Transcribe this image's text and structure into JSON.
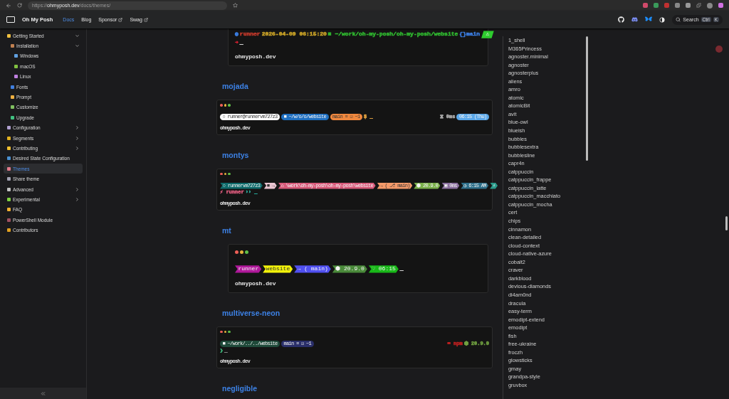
{
  "browser": {
    "url_scheme": "https://",
    "url_host": "ohmyposh.dev",
    "url_path": "/docs/themes/"
  },
  "navbar": {
    "brand": "Oh My Posh",
    "links": [
      {
        "label": "Docs",
        "selected": true,
        "external": false
      },
      {
        "label": "Blog",
        "selected": false,
        "external": false
      },
      {
        "label": "Sponsor",
        "selected": false,
        "external": true
      },
      {
        "label": "Swag",
        "selected": false,
        "external": true
      }
    ],
    "search": {
      "label": "Search",
      "keys": [
        "Ctrl",
        "K"
      ]
    }
  },
  "sidebar": {
    "items": [
      {
        "label": "Getting Started",
        "color": "#f0c040",
        "expanded": true,
        "selected": false,
        "children": [
          {
            "label": "Installation",
            "color": "#c08050",
            "expanded": true,
            "selected": false,
            "children": [
              {
                "label": "Windows",
                "color": "#60a0e0",
                "selected": false
              },
              {
                "label": "macOS",
                "color": "#80c040",
                "selected": false
              },
              {
                "label": "Linux",
                "color": "#c080e0",
                "selected": false
              }
            ]
          },
          {
            "label": "Fonts",
            "color": "#4080e0",
            "selected": false
          },
          {
            "label": "Prompt",
            "color": "#f0b040",
            "selected": false
          },
          {
            "label": "Customize",
            "color": "#80c060",
            "selected": false
          },
          {
            "label": "Upgrade",
            "color": "#40c080",
            "selected": false
          }
        ]
      },
      {
        "label": "Configuration",
        "color": "#b0a0d0",
        "expanded": false,
        "selected": false
      },
      {
        "label": "Segments",
        "color": "#e0b020",
        "expanded": false,
        "selected": false
      },
      {
        "label": "Contributing",
        "color": "#f0c030",
        "expanded": false,
        "selected": false
      },
      {
        "label": "Desired State Configuration",
        "color": "#4a90d0",
        "selected": false
      },
      {
        "label": "Themes",
        "color": "#e07a8a",
        "selected": true
      },
      {
        "label": "Share theme",
        "color": "#a0a0b0",
        "selected": false
      },
      {
        "label": "Advanced",
        "color": "#c0c0c0",
        "expanded": false,
        "selected": false
      },
      {
        "label": "Experimental",
        "color": "#80d040",
        "expanded": false,
        "selected": false
      },
      {
        "label": "FAQ",
        "color": "#f0b030",
        "selected": false
      },
      {
        "label": "PowerShell Module",
        "color": "#a05060",
        "selected": false
      },
      {
        "label": "Contributors",
        "color": "#e0a020",
        "selected": false
      }
    ]
  },
  "themes": [
    {
      "terminal": {
        "kind": "wide",
        "lines": [
          {
            "segments": [
              {
                "text": "◉",
                "kind": "text",
                "color": "#3b7de0"
              },
              {
                "text": "runner",
                "kind": "text",
                "color": "#c0392b"
              },
              {
                "text": "2026-04-09 06:15:20",
                "kind": "text",
                "color": "#c9a227"
              },
              {
                "text": "■ ~/work/oh-my-posh/oh-my-posh/website",
                "kind": "text",
                "color": "#2fb52f"
              },
              {
                "text": "{}main",
                "kind": "text",
                "color": "#3b7de0"
              },
              {
                "text": "⚠",
                "kind": "slant",
                "color": "#2ecc2e"
              }
            ]
          },
          {
            "segments": [
              {
                "text": "➜",
                "kind": "text",
                "color": "#d02030"
              },
              {
                "text": "_",
                "kind": "text",
                "color": "#dddddd"
              }
            ]
          }
        ],
        "footer": "ohmyposh.dev"
      }
    },
    {
      "heading": "mojada",
      "terminal": {
        "kind": "compact",
        "lines": [
          {
            "segments": [
              {
                "text": "○ runner@runnervm727z3",
                "kind": "pill",
                "color": "#ffffff"
              },
              {
                "text": "■ ~/w/o/o/website",
                "kind": "pill",
                "color": "#1f6fc0"
              },
              {
                "text": "main ≡ ☑ ~1",
                "kind": "pill",
                "color": "#f0883e"
              },
              {
                "text": "$ _",
                "kind": "text",
                "color": "#e0a040"
              }
            ],
            "right_segments": [
              {
                "text": "⧖ 0ms",
                "kind": "text",
                "color": "#aaaaaa"
              },
              {
                "text": "06:15 (Thu)",
                "kind": "pill",
                "color": "#5aa7e8"
              }
            ]
          }
        ],
        "footer": "ohmyposh.dev"
      }
    },
    {
      "heading": "montys",
      "terminal": {
        "kind": "compact",
        "lines": [
          {
            "segments": [
              {
                "text": "○ runnervm727z3",
                "kind": "powerline",
                "color": "#0e6b6b"
              },
              {
                "text": "■ →",
                "kind": "powerline",
                "color": "#e9c4d0"
              },
              {
                "text": "⌂ \\work\\oh-my-posh\\oh-my-posh\\website",
                "kind": "powerline",
                "color": "#d85a7a"
              },
              {
                "text": "→ ( ⎇ main)",
                "kind": "powerline",
                "color": "#f49a6a"
              },
              {
                "text": "⬢ 20.9.0",
                "kind": "powerline",
                "color": "#7ab04a"
              },
              {
                "text": "▣ 0ms",
                "kind": "powerline",
                "color": "#8a6f9e"
              },
              {
                "text": "◷ 6:15 AM",
                "kind": "powerline",
                "color": "#2e6f8a"
              },
              {
                "text": "⚡",
                "kind": "powerline",
                "color": "#2a9a8a"
              }
            ]
          },
          {
            "segments": [
              {
                "text": "⚡ runner",
                "kind": "text",
                "color": "#d85a7a"
              },
              {
                "text": "›› _",
                "kind": "text",
                "color": "#2ab0a0"
              }
            ]
          }
        ],
        "footer": "ohmyposh.dev"
      }
    },
    {
      "heading": "mt",
      "terminal": {
        "kind": "wide",
        "lines": [
          {
            "segments": [
              {
                "text": "runner",
                "kind": "powerline",
                "color": "#b0189a"
              },
              {
                "text": "website",
                "kind": "powerline",
                "color": "#f2f20a"
              },
              {
                "text": "→ ( main)",
                "kind": "powerline",
                "color": "#5050f0"
              },
              {
                "text": "⬢ 20.9.0",
                "kind": "powerline",
                "color": "#4a8a3a"
              },
              {
                "text": "♡ 06:15",
                "kind": "powerline",
                "color": "#18b818"
              },
              {
                "text": "_",
                "kind": "text",
                "color": "#dddddd"
              }
            ]
          }
        ],
        "footer": "ohmyposh.dev"
      }
    },
    {
      "heading": "multiverse-neon",
      "terminal": {
        "kind": "compact",
        "lines": [
          {
            "segments": [
              {
                "text": "■ ~/work/../../website",
                "kind": "pill",
                "color": "#1f4a3a"
              },
              {
                "text": "main ≡ ☑ ~1",
                "kind": "pill",
                "color": "#2a2f6a"
              }
            ],
            "right_segments": [
              {
                "text": "⌨ npm",
                "kind": "text",
                "color": "#c02020"
              },
              {
                "text": "⬢ 20.9.0",
                "kind": "text",
                "color": "#70a040"
              }
            ]
          },
          {
            "segments": [
              {
                "text": "❯",
                "kind": "text",
                "color": "#40c080"
              },
              {
                "text": "_",
                "kind": "text",
                "color": "#888888"
              }
            ]
          }
        ],
        "footer": "ohmyposh.dev"
      }
    },
    {
      "heading": "negligible"
    }
  ],
  "toc": [
    "1_shell",
    "M365Princess",
    "agnoster.minimal",
    "agnoster",
    "agnosterplus",
    "aliens",
    "amro",
    "atomic",
    "atomicBit",
    "avit",
    "blue-owl",
    "blueish",
    "bubbles",
    "bubblesextra",
    "bubblesline",
    "capr4n",
    "catppuccin",
    "catppuccin_frappe",
    "catppuccin_latte",
    "catppuccin_macchiato",
    "catppuccin_mocha",
    "cert",
    "chips",
    "cinnamon",
    "clean-detailed",
    "cloud-context",
    "cloud-native-azure",
    "cobalt2",
    "craver",
    "darkblood",
    "devious-diamonds",
    "di4am0nd",
    "dracula",
    "easy-term",
    "emodipt-extend",
    "emodipt",
    "fish",
    "free-ukraine",
    "froczh",
    "glowsticks",
    "gmay",
    "grandpa-style",
    "gruvbox"
  ]
}
